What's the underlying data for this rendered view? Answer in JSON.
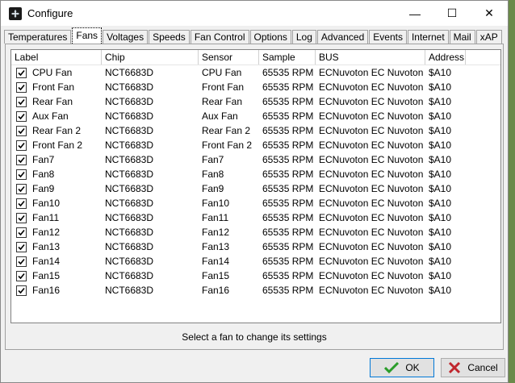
{
  "window": {
    "title": "Configure",
    "minimize_glyph": "—",
    "maximize_glyph": "☐",
    "close_glyph": "✕"
  },
  "tabs": [
    {
      "label": "Temperatures",
      "active": false
    },
    {
      "label": "Fans",
      "active": true
    },
    {
      "label": "Voltages",
      "active": false
    },
    {
      "label": "Speeds",
      "active": false
    },
    {
      "label": "Fan Control",
      "active": false
    },
    {
      "label": "Options",
      "active": false
    },
    {
      "label": "Log",
      "active": false
    },
    {
      "label": "Advanced",
      "active": false
    },
    {
      "label": "Events",
      "active": false
    },
    {
      "label": "Internet",
      "active": false
    },
    {
      "label": "Mail",
      "active": false
    },
    {
      "label": "xAP",
      "active": false
    }
  ],
  "table": {
    "columns": [
      "Label",
      "Chip",
      "Sensor",
      "Sample",
      "BUS",
      "Address"
    ],
    "rows": [
      {
        "label": "CPU Fan",
        "chip": "NCT6683D",
        "sensor": "CPU Fan",
        "sample": "65535 RPM",
        "bus": "ECNuvoton EC Nuvoton",
        "address": "$A10",
        "checked": true
      },
      {
        "label": "Front Fan",
        "chip": "NCT6683D",
        "sensor": "Front Fan",
        "sample": "65535 RPM",
        "bus": "ECNuvoton EC Nuvoton",
        "address": "$A10",
        "checked": true
      },
      {
        "label": "Rear Fan",
        "chip": "NCT6683D",
        "sensor": "Rear Fan",
        "sample": "65535 RPM",
        "bus": "ECNuvoton EC Nuvoton",
        "address": "$A10",
        "checked": true
      },
      {
        "label": "Aux Fan",
        "chip": "NCT6683D",
        "sensor": "Aux Fan",
        "sample": "65535 RPM",
        "bus": "ECNuvoton EC Nuvoton",
        "address": "$A10",
        "checked": true
      },
      {
        "label": "Rear Fan 2",
        "chip": "NCT6683D",
        "sensor": "Rear Fan 2",
        "sample": "65535 RPM",
        "bus": "ECNuvoton EC Nuvoton",
        "address": "$A10",
        "checked": true
      },
      {
        "label": "Front Fan 2",
        "chip": "NCT6683D",
        "sensor": "Front Fan 2",
        "sample": "65535 RPM",
        "bus": "ECNuvoton EC Nuvoton",
        "address": "$A10",
        "checked": true
      },
      {
        "label": "Fan7",
        "chip": "NCT6683D",
        "sensor": "Fan7",
        "sample": "65535 RPM",
        "bus": "ECNuvoton EC Nuvoton",
        "address": "$A10",
        "checked": true
      },
      {
        "label": "Fan8",
        "chip": "NCT6683D",
        "sensor": "Fan8",
        "sample": "65535 RPM",
        "bus": "ECNuvoton EC Nuvoton",
        "address": "$A10",
        "checked": true
      },
      {
        "label": "Fan9",
        "chip": "NCT6683D",
        "sensor": "Fan9",
        "sample": "65535 RPM",
        "bus": "ECNuvoton EC Nuvoton",
        "address": "$A10",
        "checked": true
      },
      {
        "label": "Fan10",
        "chip": "NCT6683D",
        "sensor": "Fan10",
        "sample": "65535 RPM",
        "bus": "ECNuvoton EC Nuvoton",
        "address": "$A10",
        "checked": true
      },
      {
        "label": "Fan11",
        "chip": "NCT6683D",
        "sensor": "Fan11",
        "sample": "65535 RPM",
        "bus": "ECNuvoton EC Nuvoton",
        "address": "$A10",
        "checked": true
      },
      {
        "label": "Fan12",
        "chip": "NCT6683D",
        "sensor": "Fan12",
        "sample": "65535 RPM",
        "bus": "ECNuvoton EC Nuvoton",
        "address": "$A10",
        "checked": true
      },
      {
        "label": "Fan13",
        "chip": "NCT6683D",
        "sensor": "Fan13",
        "sample": "65535 RPM",
        "bus": "ECNuvoton EC Nuvoton",
        "address": "$A10",
        "checked": true
      },
      {
        "label": "Fan14",
        "chip": "NCT6683D",
        "sensor": "Fan14",
        "sample": "65535 RPM",
        "bus": "ECNuvoton EC Nuvoton",
        "address": "$A10",
        "checked": true
      },
      {
        "label": "Fan15",
        "chip": "NCT6683D",
        "sensor": "Fan15",
        "sample": "65535 RPM",
        "bus": "ECNuvoton EC Nuvoton",
        "address": "$A10",
        "checked": true
      },
      {
        "label": "Fan16",
        "chip": "NCT6683D",
        "sensor": "Fan16",
        "sample": "65535 RPM",
        "bus": "ECNuvoton EC Nuvoton",
        "address": "$A10",
        "checked": true
      }
    ]
  },
  "status_text": "Select a fan to change its settings",
  "buttons": {
    "ok_label": "OK",
    "cancel_label": "Cancel"
  },
  "colors": {
    "ok_icon": "#2a9d2a",
    "cancel_icon": "#c0262d",
    "focus_border": "#0078d7"
  },
  "icons": {
    "app": "fan-app-icon",
    "ok": "checkmark-icon",
    "cancel": "cross-icon"
  }
}
